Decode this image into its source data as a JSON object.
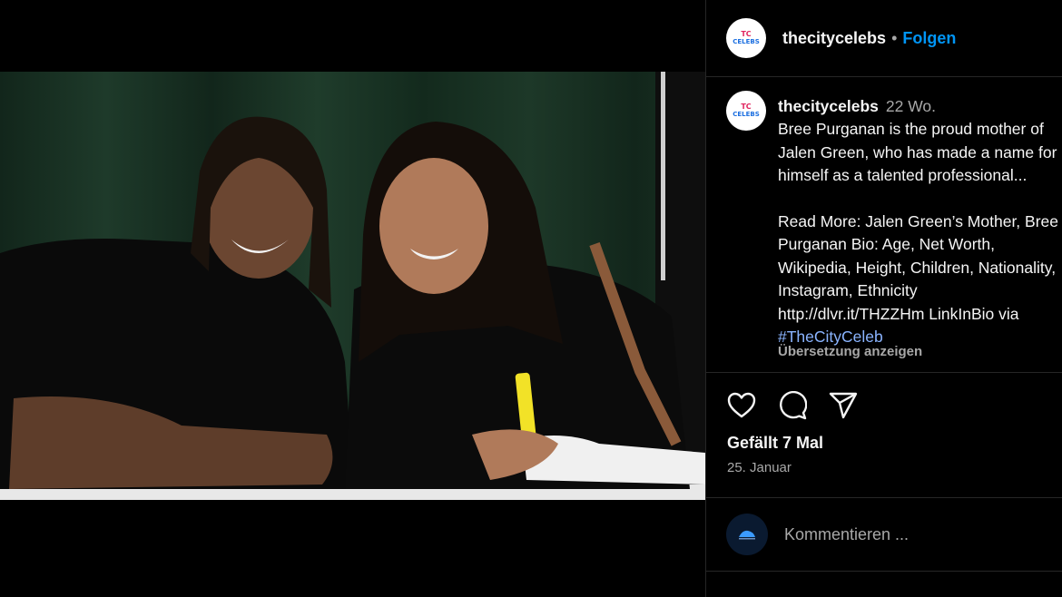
{
  "post": {
    "username": "thecitycelebs",
    "follow_label": "Folgen",
    "separator": "•"
  },
  "caption": {
    "username": "thecitycelebs",
    "time_ago": "22 Wo.",
    "lines": [
      "Bree Purganan is the proud mother of",
      "Jalen Green, who has made a name for",
      "himself as a talented professional...",
      "",
      "Read More: Jalen Green’s Mother, Bree",
      "Purganan Bio: Age, Net Worth,",
      "Wikipedia, Height, Children, Nationality,",
      "Instagram, Ethnicity",
      "http://dlvr.it/THZZHm LinkInBio via"
    ],
    "hashtag": "#TheCityCeleb",
    "translate_label": "Übersetzung anzeigen"
  },
  "actions": {
    "like_icon": "heart-icon",
    "comment_icon": "comment-bubble-icon",
    "share_icon": "paper-plane-icon"
  },
  "likes_text": "Gefällt 7 Mal",
  "date_text": "25. Januar",
  "comment": {
    "placeholder": "Kommentieren ..."
  },
  "colors": {
    "background": "#000000",
    "accent_blue": "#0095f6",
    "hashtag": "#8ab4ff",
    "muted": "#a8a8a8",
    "divider": "#262626"
  }
}
